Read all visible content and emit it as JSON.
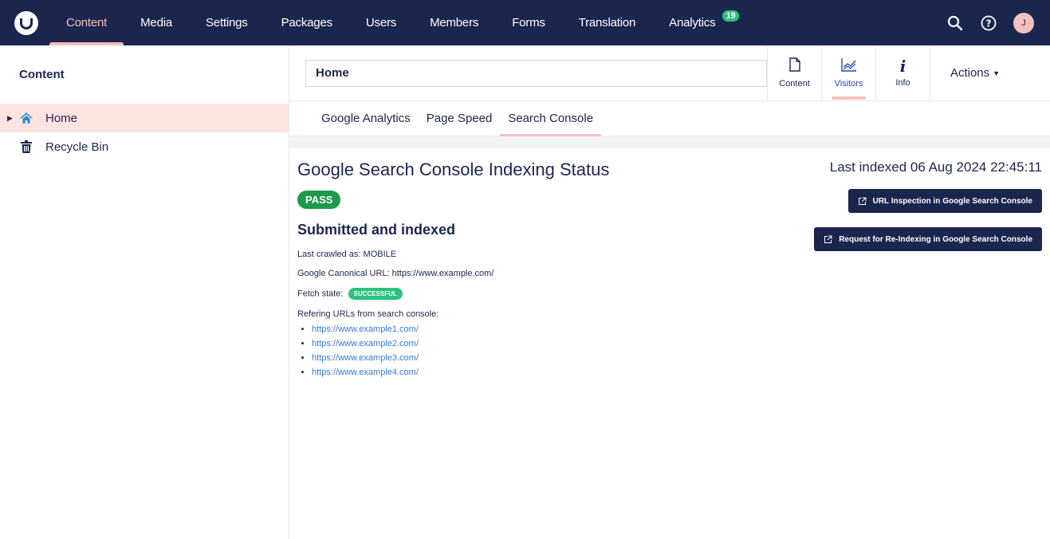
{
  "topbar": {
    "logo_icon": "umbraco-logo-icon",
    "nav": [
      {
        "label": "Content",
        "active": true
      },
      {
        "label": "Media"
      },
      {
        "label": "Settings"
      },
      {
        "label": "Packages"
      },
      {
        "label": "Users"
      },
      {
        "label": "Members"
      },
      {
        "label": "Forms"
      },
      {
        "label": "Translation"
      },
      {
        "label": "Analytics",
        "badge": "19"
      }
    ],
    "search_icon": "search-icon",
    "help_icon": "help-icon",
    "avatar_initial": "J"
  },
  "sidebar": {
    "title": "Content",
    "items": [
      {
        "label": "Home",
        "icon": "home-icon",
        "active": true
      },
      {
        "label": "Recycle Bin",
        "icon": "trash-icon"
      }
    ]
  },
  "header": {
    "node_name": "Home",
    "apps": [
      {
        "label": "Content",
        "icon": "document-icon"
      },
      {
        "label": "Visitors",
        "icon": "chart-icon",
        "active": true
      },
      {
        "label": "Info",
        "icon": "info-icon"
      }
    ],
    "actions_label": "Actions"
  },
  "subtabs": [
    {
      "label": "Google Analytics"
    },
    {
      "label": "Page Speed"
    },
    {
      "label": "Search Console",
      "active": true
    }
  ],
  "console": {
    "title": "Google Search Console Indexing Status",
    "last_indexed": "Last indexed 06 Aug 2024 22:45:11",
    "verdict": "PASS",
    "coverage_state": "Submitted and indexed",
    "last_crawled": "Last crawled as: MOBILE",
    "canonical": "Google Canonical URL: https://www.example.com/",
    "fetch_state_label": "Fetch state:",
    "fetch_state": "SUCCESSFUL",
    "referring_label": "Refering URLs from search console:",
    "referring_urls": [
      "https://www.example1.com/",
      "https://www.example2.com/",
      "https://www.example3.com/",
      "https://www.example4.com/"
    ],
    "inspect_button": "URL Inspection in Google Search Console",
    "reindex_button": "Request for Re-Indexing in Google Search Console"
  },
  "colors": {
    "navy": "#1b264f",
    "accent_pink": "#f5c1bc",
    "pass_green": "#1c9a4a",
    "success_green": "#2bc37c",
    "link_blue": "#3879d9"
  }
}
